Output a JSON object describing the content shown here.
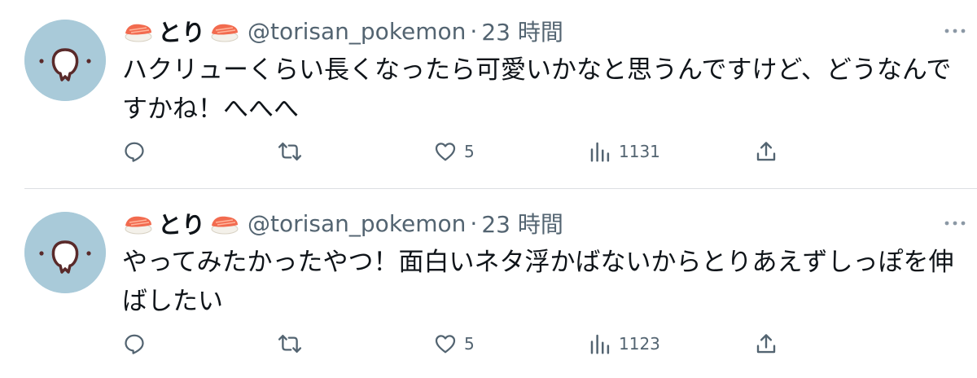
{
  "tweets": [
    {
      "display_name": "とり",
      "handle": "@torisan_pokemon",
      "separator": "·",
      "time": "23 時間",
      "text": "ハクリューくらい長くなったら可愛いかなと思うんですけど、どうなんですかね！へへへ",
      "like_count": "5",
      "view_count": "1131"
    },
    {
      "display_name": "とり",
      "handle": "@torisan_pokemon",
      "separator": "·",
      "time": "23 時間",
      "text": "やってみたかったやつ！面白いネタ浮かばないからとりあえずしっぽを伸ばしたい",
      "like_count": "5",
      "view_count": "1123"
    }
  ],
  "colors": {
    "text": "#0f1419",
    "secondary": "#536471",
    "avatar_bg": "#a9cad9",
    "divider": "#dcdfe2"
  },
  "icons": [
    "sushi-emoji-icon",
    "more-dots-icon",
    "reply-icon",
    "retweet-icon",
    "like-heart-icon",
    "views-bar-chart-icon",
    "share-icon"
  ]
}
